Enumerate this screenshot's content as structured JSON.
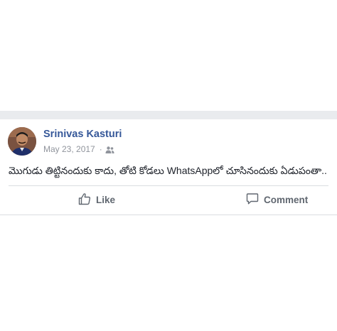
{
  "post": {
    "author": "Srinivas Kasturi",
    "date": "May 23, 2017",
    "separator": "·",
    "privacy_icon": "friends-icon",
    "text": "మొగుడు తిట్టినందుకు కాదు, తోటి కోడలు WhatsAppలో చూసినందుకు ఏడుపంతా..",
    "actions": {
      "like_label": "Like",
      "like_icon": "thumbs-up-icon",
      "comment_label": "Comment",
      "comment_icon": "speech-bubble-icon"
    }
  },
  "colors": {
    "author": "#365899",
    "meta": "#90949c",
    "body_text": "#1d2129",
    "action_text": "#606770",
    "feed_background": "#e9ebee"
  }
}
